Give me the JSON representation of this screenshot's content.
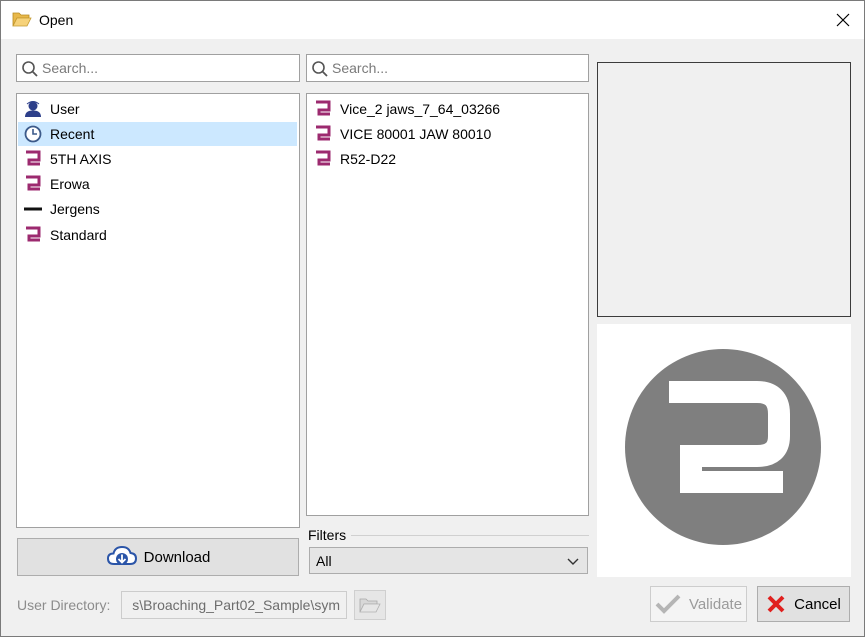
{
  "window": {
    "title": "Open"
  },
  "left_panel": {
    "search_placeholder": "Search...",
    "items": [
      {
        "label": "User",
        "icon": "user-icon"
      },
      {
        "label": "Recent",
        "icon": "clock-icon",
        "selected": true
      },
      {
        "label": "5TH AXIS",
        "icon": "brand-2-icon"
      },
      {
        "label": "Erowa",
        "icon": "brand-2-icon"
      },
      {
        "label": "Jergens",
        "icon": "dash-icon"
      },
      {
        "label": "Standard",
        "icon": "brand-2-icon"
      }
    ],
    "download_label": "Download"
  },
  "middle_panel": {
    "search_placeholder": "Search...",
    "items": [
      {
        "label": "Vice_2 jaws_7_64_03266",
        "icon": "brand-2-icon"
      },
      {
        "label": "VICE 80001 JAW 80010",
        "icon": "brand-2-icon"
      },
      {
        "label": "R52-D22",
        "icon": "brand-2-icon"
      }
    ],
    "filters_label": "Filters",
    "filter_value": "All"
  },
  "footer": {
    "user_directory_label": "User Directory:",
    "user_directory_value": "s\\Broaching_Part02_Sample\\sym",
    "validate_label": "Validate",
    "cancel_label": "Cancel"
  },
  "colors": {
    "brand": "#9c2a6f",
    "selection": "#cce8ff",
    "logo_gray": "#7f7f7f",
    "cancel_red": "#e0201e"
  }
}
